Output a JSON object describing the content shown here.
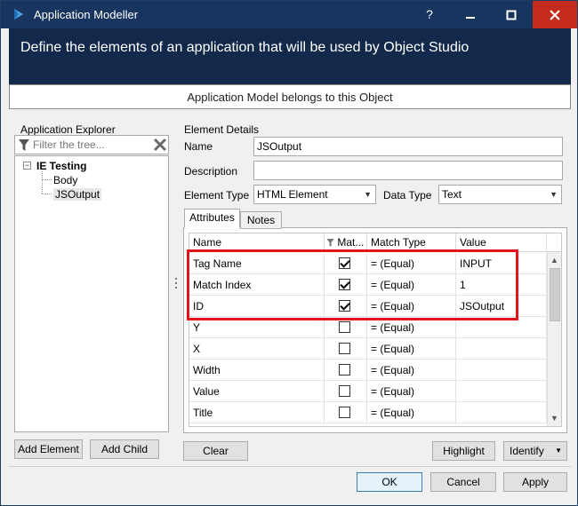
{
  "window": {
    "title": "Application Modeller",
    "controls": {
      "help": "?",
      "minimize": "—",
      "maximize": "☐",
      "close": "✕"
    },
    "accent": "#17355f",
    "header_color": "#13294b",
    "close_color": "#c42b1c"
  },
  "header": {
    "description": "Define the elements of an application that will be used by Object Studio",
    "belongs_label": "Application Model belongs to this Object"
  },
  "explorer": {
    "label": "Application Explorer",
    "filter_placeholder": "Filter the tree...",
    "tree": {
      "root": "IE Testing",
      "children": [
        "Body",
        "JSOutput"
      ]
    },
    "add_element": "Add Element",
    "add_child": "Add Child"
  },
  "details": {
    "label": "Element Details",
    "name_label": "Name",
    "name_value": "JSOutput",
    "description_label": "Description",
    "description_value": "",
    "element_type_label": "Element Type",
    "element_type_value": "HTML Element",
    "data_type_label": "Data Type",
    "data_type_value": "Text",
    "tabs": [
      "Attributes",
      "Notes"
    ]
  },
  "attributes": {
    "columns": [
      "Name",
      "Mat...",
      "Match Type",
      "Value"
    ],
    "rows": [
      {
        "name": "Tag Name",
        "match": true,
        "match_type": "=  (Equal)",
        "value": "INPUT"
      },
      {
        "name": "Match Index",
        "match": true,
        "match_type": "=  (Equal)",
        "value": "1"
      },
      {
        "name": "ID",
        "match": true,
        "match_type": "=  (Equal)",
        "value": "JSOutput"
      },
      {
        "name": "Y",
        "match": false,
        "match_type": "=  (Equal)",
        "value": ""
      },
      {
        "name": "X",
        "match": false,
        "match_type": "=  (Equal)",
        "value": ""
      },
      {
        "name": "Width",
        "match": false,
        "match_type": "=  (Equal)",
        "value": ""
      },
      {
        "name": "Value",
        "match": false,
        "match_type": "=  (Equal)",
        "value": ""
      },
      {
        "name": "Title",
        "match": false,
        "match_type": "=  (Equal)",
        "value": ""
      }
    ],
    "highlight_color": "#e3141c"
  },
  "actions": {
    "clear": "Clear",
    "highlight": "Highlight",
    "identify": "Identify",
    "ok": "OK",
    "cancel": "Cancel",
    "apply": "Apply"
  }
}
